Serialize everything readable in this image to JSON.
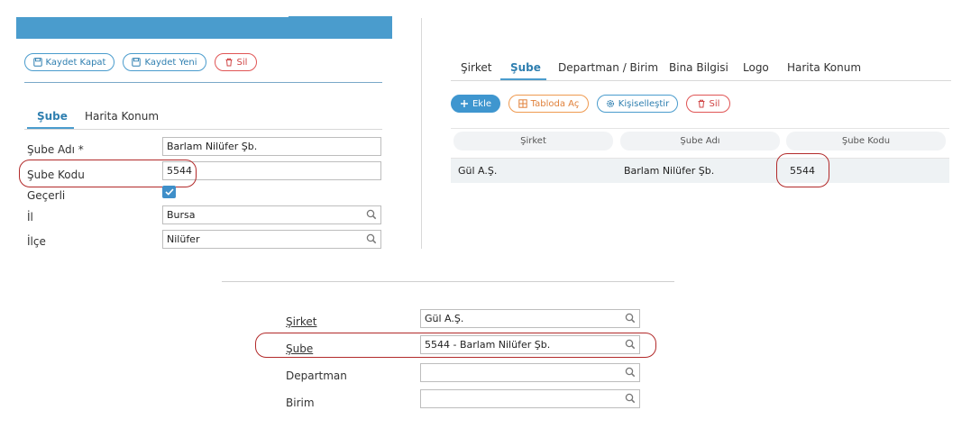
{
  "left_form": {
    "toolbar": {
      "save_close": "Kaydet Kapat",
      "save_new": "Kaydet Yeni",
      "delete": "Sil"
    },
    "tabs": [
      {
        "label": "Şube",
        "active": true
      },
      {
        "label": "Harita Konum",
        "active": false
      }
    ],
    "fields": {
      "name_label": "Şube Adı *",
      "name_value": "Barlam Nilüfer Şb.",
      "code_label": "Şube Kodu",
      "code_value": "5544",
      "valid_label": "Geçerli",
      "valid_checked": true,
      "province_label": "İl",
      "province_value": "Bursa",
      "district_label": "İlçe",
      "district_value": "Nilüfer"
    }
  },
  "right_panel": {
    "tabs": [
      {
        "label": "Şirket",
        "active": false
      },
      {
        "label": "Şube",
        "active": true
      },
      {
        "label": "Departman / Birim",
        "active": false
      },
      {
        "label": "Bina Bilgisi",
        "active": false
      },
      {
        "label": "Logo",
        "active": false
      },
      {
        "label": "Harita Konum",
        "active": false
      }
    ],
    "toolbar": {
      "add": "Ekle",
      "open_table": "Tabloda Aç",
      "customize": "Kişiselleştir",
      "delete": "Sil"
    },
    "grid": {
      "columns": [
        "Şirket",
        "Şube Adı",
        "Şube Kodu"
      ],
      "rows": [
        [
          "Gül A.Ş.",
          "Barlam Nilüfer Şb.",
          "5544"
        ]
      ]
    }
  },
  "bottom_form": {
    "company_label": "Şirket",
    "company_value": "Gül A.Ş.",
    "branch_label": "Şube",
    "branch_value": "5544 - Barlam Nilüfer Şb.",
    "department_label": "Departman",
    "department_value": "",
    "unit_label": "Birim",
    "unit_value": ""
  },
  "colors": {
    "accent": "#4a9ccd",
    "danger": "#e05555",
    "warning": "#ef9a50",
    "highlight": "#b22a2a"
  }
}
